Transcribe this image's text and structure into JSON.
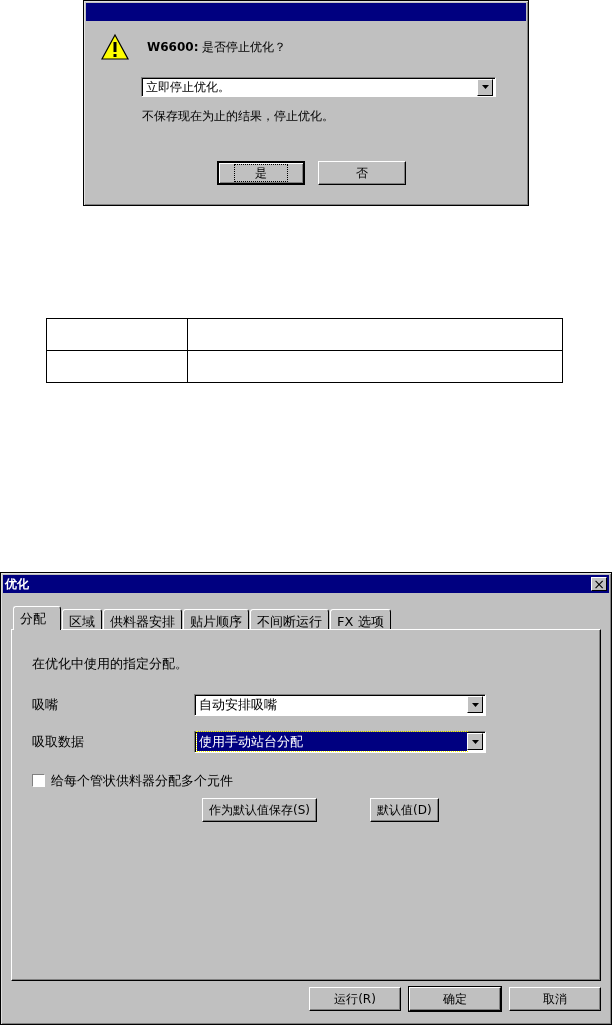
{
  "confirm_dialog": {
    "message": "**W6600:** 是否停止优化？",
    "dropdown": {
      "value": "立即停止优化。"
    },
    "description": "不保存现在为止的结果，停止优化。",
    "buttons": [
      {
        "label": "是",
        "focused": true
      },
      {
        "label": "否",
        "focused": false
      }
    ]
  },
  "options_dialog": {
    "title": "优化",
    "close": "×",
    "tabs": [
      {
        "label": "分配",
        "selected": true
      },
      {
        "label": "区域",
        "selected": false
      },
      {
        "label": "供料器安排",
        "selected": false
      },
      {
        "label": "贴片顺序",
        "selected": false
      },
      {
        "label": "不间断运行",
        "selected": false
      },
      {
        "label": "FX 选项",
        "selected": false
      }
    ],
    "description": "在优化中使用的指定分配。",
    "fields": [
      {
        "label": "吸嘴",
        "value": "自动安排吸嘴",
        "highlighted": false
      },
      {
        "label": "吸取数据",
        "value": "使用手动站台分配",
        "highlighted": true
      }
    ],
    "checkbox": {
      "label": "给每个管状供料器分配多个元件",
      "checked": false
    },
    "panel_buttons": [
      "作为默认值保存(S)",
      "默认值(D)"
    ],
    "buttons": [
      {
        "label": "运行(R)",
        "default": false
      },
      {
        "label": "确定",
        "default": true
      },
      {
        "label": "取消",
        "default": false
      }
    ]
  }
}
